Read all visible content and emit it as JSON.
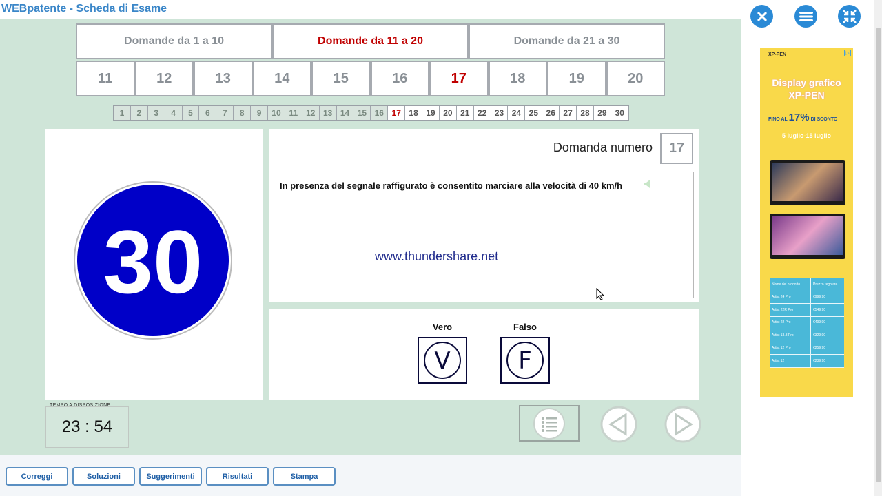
{
  "app": {
    "title": "WEBpatente - Scheda di Esame"
  },
  "range_tabs": [
    {
      "label": "Domande  da 1 a 10",
      "active": false
    },
    {
      "label": "Domande  da 11 a 20",
      "active": true
    },
    {
      "label": "Domande  da 21 a 30",
      "active": false
    }
  ],
  "question_numbers": [
    "11",
    "12",
    "13",
    "14",
    "15",
    "16",
    "17",
    "18",
    "19",
    "20"
  ],
  "current_question": "17",
  "small_numbers": [
    "1",
    "2",
    "3",
    "4",
    "5",
    "6",
    "7",
    "8",
    "9",
    "10",
    "11",
    "12",
    "13",
    "14",
    "15",
    "16",
    "17",
    "18",
    "19",
    "20",
    "21",
    "22",
    "23",
    "24",
    "25",
    "26",
    "27",
    "28",
    "29",
    "30"
  ],
  "sign": {
    "value": "30",
    "fill_color": "#0000c8",
    "border_color": "#bbbbbb"
  },
  "question": {
    "label": "Domanda numero",
    "number": "17",
    "text": "In presenza del segnale raffigurato è consentito marciare alla velocità di 40 km/h",
    "watermark": "www.thundershare.net"
  },
  "answers": {
    "true_label": "Vero",
    "true_letter": "V",
    "false_label": "Falso",
    "false_letter": "F"
  },
  "timer": {
    "label": "TEMPO A DISPOSIZIONE",
    "value": "23 : 54"
  },
  "bottom_buttons": {
    "correggi": "Correggi",
    "soluzioni": "Soluzioni",
    "suggerimenti": "Suggerimenti",
    "risultati": "Risultati",
    "stampa": "Stampa"
  },
  "ad": {
    "brand": "XP-PEN",
    "headline_1": "Display grafico",
    "headline_2": "XP-PEN",
    "promo_prefix": "FINO AL",
    "promo_pct": "17%",
    "promo_suffix": "DI SCONTO",
    "dates": "5 luglio-15 luglio",
    "table_header": [
      "Nome del prodotto",
      "Prezzo regolare"
    ],
    "table_rows": [
      [
        "Artist 24 Pro",
        "€999,90"
      ],
      [
        "Artist 22R Pro",
        "€549,90"
      ],
      [
        "Artist 22 Pro",
        "€499,90"
      ],
      [
        "Artist 13.3 Pro",
        "€329,90"
      ],
      [
        "Artist 12 Pro",
        "€259,90"
      ],
      [
        "Artist 12",
        "€239,90"
      ]
    ]
  },
  "colors": {
    "accent_blue": "#2a8ad6",
    "active_red": "#c00000",
    "main_bg": "#cfe5d8"
  }
}
